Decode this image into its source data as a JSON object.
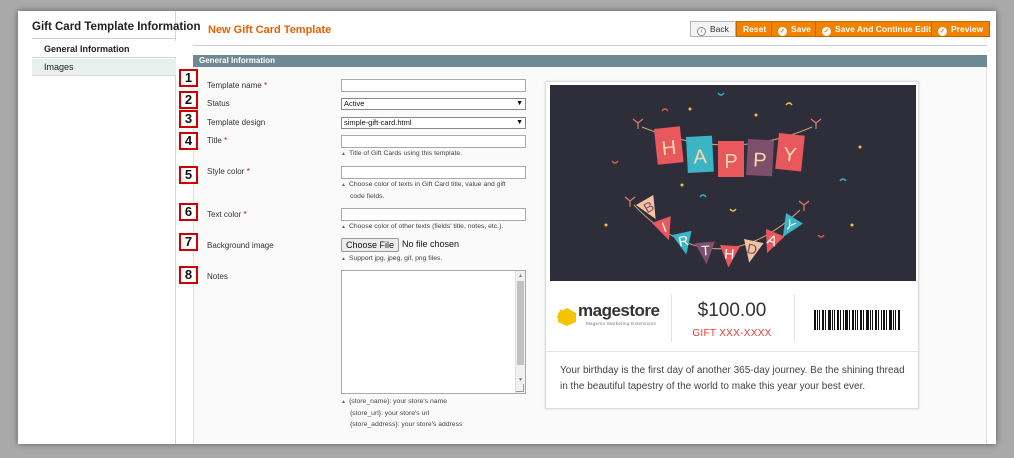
{
  "sidebar": {
    "title": "Gift Card Template Information",
    "items": [
      {
        "label": "General Information",
        "active": true
      },
      {
        "label": "Images",
        "active": false
      }
    ]
  },
  "header": {
    "title": "New Gift Card Template",
    "buttons": {
      "back": "Back",
      "reset": "Reset",
      "save": "Save",
      "save_continue": "Save And Continue Edit",
      "preview": "Preview"
    }
  },
  "section": {
    "title": "General Information"
  },
  "form": {
    "markers": [
      "1",
      "2",
      "3",
      "4",
      "5",
      "6",
      "7",
      "8"
    ],
    "fields": {
      "template_name": {
        "label": "Template name",
        "required": "*",
        "value": ""
      },
      "status": {
        "label": "Status",
        "value": "Active"
      },
      "template_design": {
        "label": "Template design",
        "value": "simple-gift-card.html"
      },
      "title": {
        "label": "Title",
        "required": "*",
        "value": "",
        "hint": "Title of Gift Cards using this template."
      },
      "style_color": {
        "label": "Style color",
        "required": "*",
        "value": "",
        "hint_line1": "Choose color of texts in Gift Card title, value and gift",
        "hint_line2": "code fields."
      },
      "text_color": {
        "label": "Text color",
        "required": "*",
        "value": "",
        "hint": "Choose color of other texts (fields' title, notes, etc.)."
      },
      "background_image": {
        "label": "Background image",
        "button": "Choose File",
        "status": "No file chosen",
        "hint": "Support jpg, jpeg, gif, png files."
      },
      "notes": {
        "label": "Notes",
        "value": "",
        "hint_lines": [
          "{store_name}: your store's name",
          "{store_url}: your store's url",
          "{store_address}: your store's address"
        ]
      }
    }
  },
  "preview_card": {
    "image_banner_top": [
      "H",
      "A",
      "P",
      "P",
      "Y"
    ],
    "image_banner_bottom": [
      "B",
      "I",
      "R",
      "T",
      "H",
      "D",
      "A",
      "Y"
    ],
    "logo_text": "magestore",
    "logo_subtext": "Magento Marketing Extensions",
    "price": "$100.00",
    "gift_code": "GIFT XXX-XXXX",
    "notes": "Your birthday is the first day of another 365-day journey. Be the shining thread in the beautiful tapestry of the world to make this year your best ever."
  },
  "colors": {
    "accent": "#f18200",
    "title": "#eb5e00",
    "section_bar": "#6f8992",
    "required": "#d00000",
    "gift_code": "#e53935",
    "card_image_bg": "#2e2d3a"
  }
}
